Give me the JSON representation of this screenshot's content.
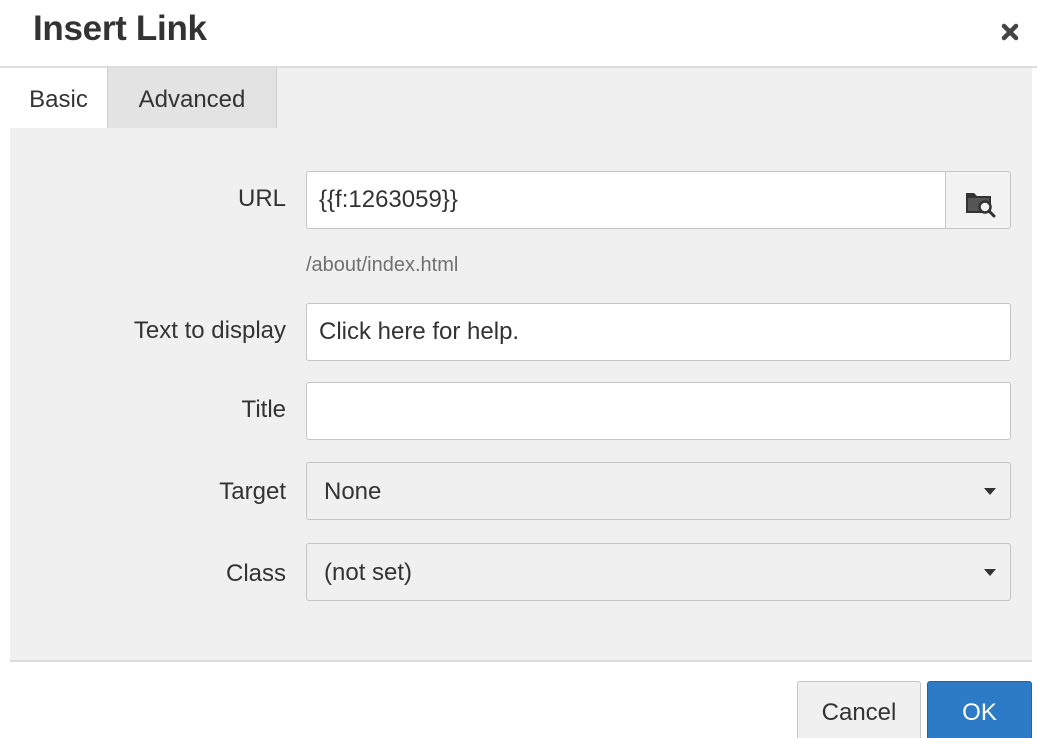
{
  "dialog": {
    "title": "Insert Link",
    "close_icon": "close-icon"
  },
  "tabs": [
    {
      "label": "Basic",
      "active": true
    },
    {
      "label": "Advanced",
      "active": false
    }
  ],
  "form": {
    "url": {
      "label": "URL",
      "value": "{{f:1263059}}",
      "browse_icon": "folder-search-icon",
      "hint": "/about/index.html"
    },
    "text_to_display": {
      "label": "Text to display",
      "value": "Click here for help."
    },
    "title": {
      "label": "Title",
      "value": ""
    },
    "target": {
      "label": "Target",
      "selected": "None"
    },
    "class": {
      "label": "Class",
      "selected": "(not set)"
    }
  },
  "footer": {
    "cancel_label": "Cancel",
    "ok_label": "OK"
  },
  "colors": {
    "primary": "#2d7bc6",
    "panel_background": "#f0f0f0"
  }
}
